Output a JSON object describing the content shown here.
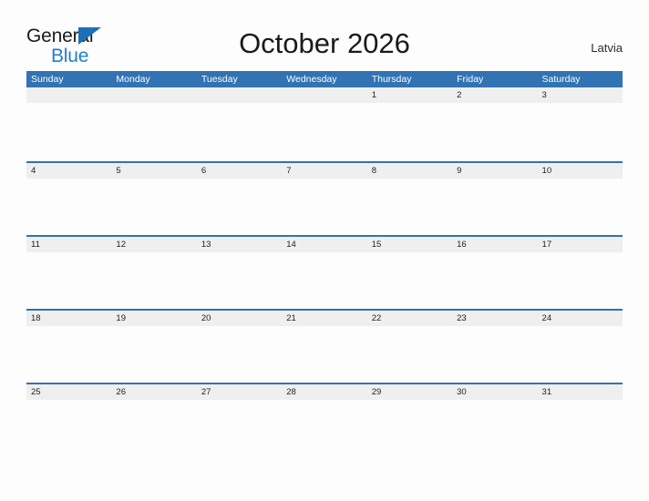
{
  "brand": {
    "name_top": "General",
    "name_bottom": "Blue",
    "triangle_icon": "brand-triangle-icon",
    "accent_color": "#1f7fd0"
  },
  "header": {
    "title": "October 2026",
    "region": "Latvia"
  },
  "theme": {
    "header_blue": "#3173b3",
    "date_strip_gray": "#efefef",
    "page_background": "#fdfdfd",
    "text_dark": "#1a1a1a"
  },
  "calendar": {
    "month": "October",
    "year": "2026",
    "weekday_headers": [
      "Sunday",
      "Monday",
      "Tuesday",
      "Wednesday",
      "Thursday",
      "Friday",
      "Saturday"
    ],
    "weeks": [
      [
        "",
        "",
        "",
        "",
        "1",
        "2",
        "3"
      ],
      [
        "4",
        "5",
        "6",
        "7",
        "8",
        "9",
        "10"
      ],
      [
        "11",
        "12",
        "13",
        "14",
        "15",
        "16",
        "17"
      ],
      [
        "18",
        "19",
        "20",
        "21",
        "22",
        "23",
        "24"
      ],
      [
        "25",
        "26",
        "27",
        "28",
        "29",
        "30",
        "31"
      ]
    ]
  }
}
